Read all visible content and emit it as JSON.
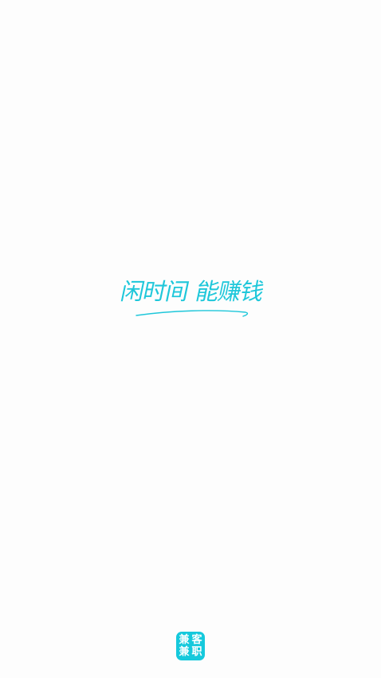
{
  "splash": {
    "slogan_part1": "闲时间",
    "slogan_part2": "能赚钱",
    "accent_color": "#1ec7da"
  },
  "logo": {
    "chars": [
      "兼",
      "客",
      "兼",
      "职"
    ],
    "background_color": "#15c9dc"
  }
}
